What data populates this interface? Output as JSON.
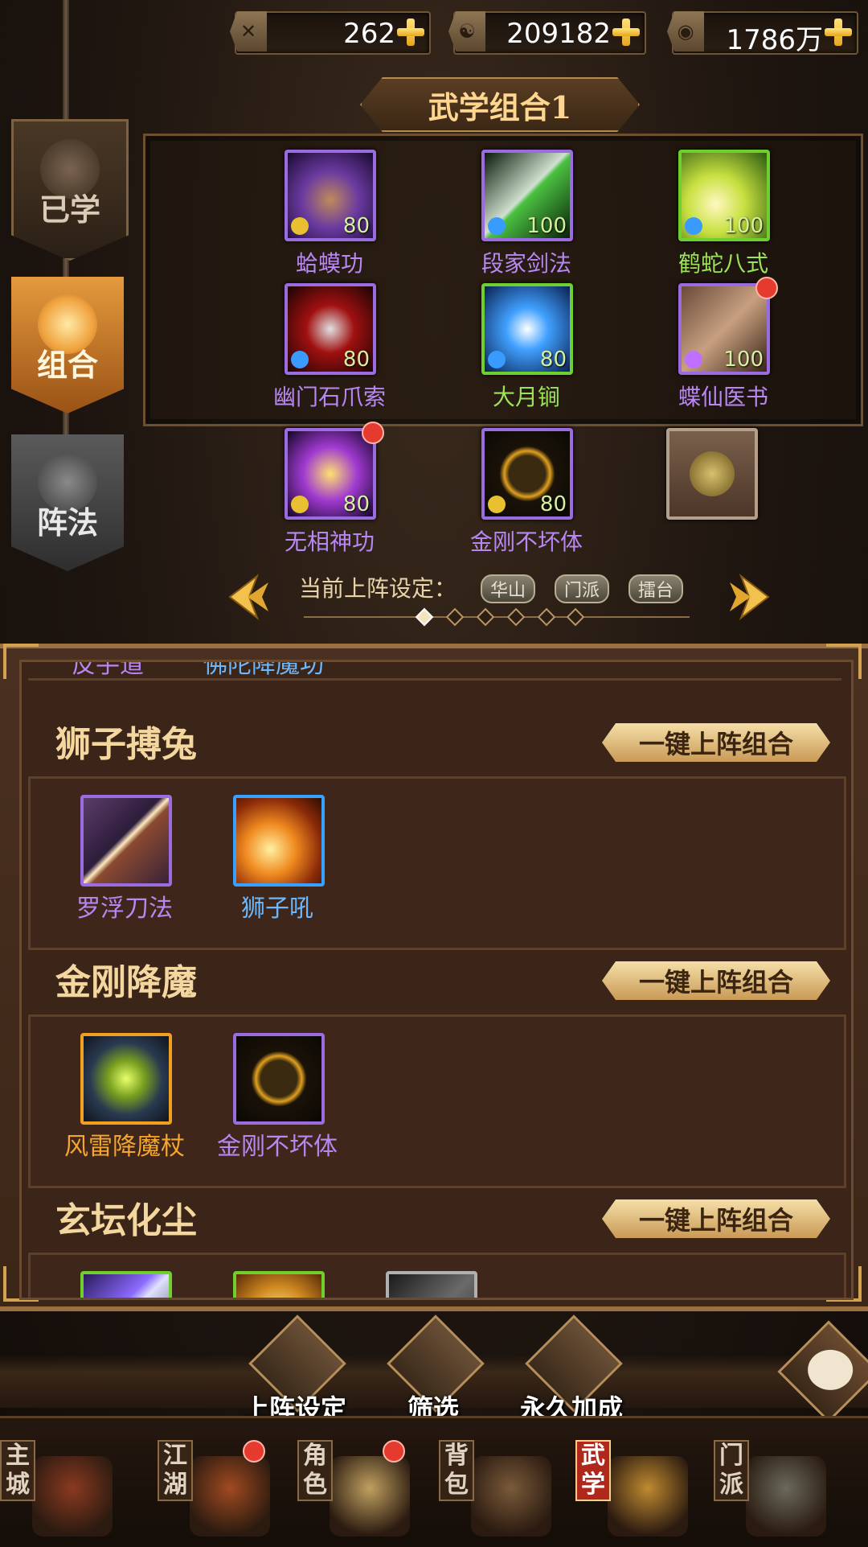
{
  "resources": [
    {
      "icon": "crossed-swords-icon",
      "value": "262"
    },
    {
      "icon": "taiji-coin-icon",
      "value": "209182"
    },
    {
      "icon": "copper-coin-icon",
      "value": "1786万"
    }
  ],
  "side_tabs": [
    {
      "label": "已学",
      "active": false
    },
    {
      "label": "组合",
      "active": true
    },
    {
      "label": "阵法",
      "active": false
    }
  ],
  "combo_title": "武学组合1",
  "equipped": [
    {
      "name": "蛤蟆功",
      "level": "80",
      "border": "#9a6cdf",
      "name_color": "#b987f2",
      "gem": "coin",
      "dot": false
    },
    {
      "name": "段家剑法",
      "level": "100",
      "border": "#9a6cdf",
      "name_color": "#b987f2",
      "gem": "blue",
      "dot": false
    },
    {
      "name": "鹤蛇八式",
      "level": "100",
      "border": "#6fcf2e",
      "name_color": "#9de35a",
      "gem": "blue",
      "dot": false
    },
    {
      "name": "幽门石爪索",
      "level": "80",
      "border": "#9a6cdf",
      "name_color": "#b987f2",
      "gem": "blue",
      "dot": false
    },
    {
      "name": "大月锏",
      "level": "80",
      "border": "#6fcf2e",
      "name_color": "#9de35a",
      "gem": "blue",
      "dot": false
    },
    {
      "name": "蝶仙医书",
      "level": "100",
      "border": "#9a6cdf",
      "name_color": "#b987f2",
      "gem": "purple",
      "dot": true
    },
    {
      "name": "无相神功",
      "level": "80",
      "border": "#9a6cdf",
      "name_color": "#b987f2",
      "gem": "coin",
      "dot": true
    },
    {
      "name": "金刚不坏体",
      "level": "80",
      "border": "#9a6cdf",
      "name_color": "#b987f2",
      "gem": "coin",
      "dot": false
    }
  ],
  "current_setting": {
    "label": "当前上阵设定：",
    "chips": [
      "华山",
      "门派",
      "擂台"
    ]
  },
  "partial_row": [
    "反手道",
    "佛陀降魔功"
  ],
  "groups": [
    {
      "title": "狮子搏兔",
      "button": "一键上阵组合",
      "items": [
        {
          "name": "罗浮刀法",
          "border": "#9a6cdf",
          "name_color": "#b987f2"
        },
        {
          "name": "狮子吼",
          "border": "#3aa0ff",
          "name_color": "#6bb8ff"
        }
      ]
    },
    {
      "title": "金刚降魔",
      "button": "一键上阵组合",
      "items": [
        {
          "name": "风雷降魔杖",
          "border": "#f0a020",
          "name_color": "#f5a530"
        },
        {
          "name": "金刚不坏体",
          "border": "#9a6cdf",
          "name_color": "#b987f2"
        }
      ]
    },
    {
      "title": "玄坛化尘",
      "button": "一键上阵组合",
      "items": []
    }
  ],
  "actions": [
    "上阵设定",
    "筛选",
    "永久加成"
  ],
  "nav": [
    {
      "label": "主城",
      "dot": false
    },
    {
      "label": "江湖",
      "dot": true
    },
    {
      "label": "角色",
      "dot": true
    },
    {
      "label": "背包",
      "dot": false
    },
    {
      "label": "武学",
      "dot": false,
      "active": true
    },
    {
      "label": "门派",
      "dot": false
    }
  ]
}
